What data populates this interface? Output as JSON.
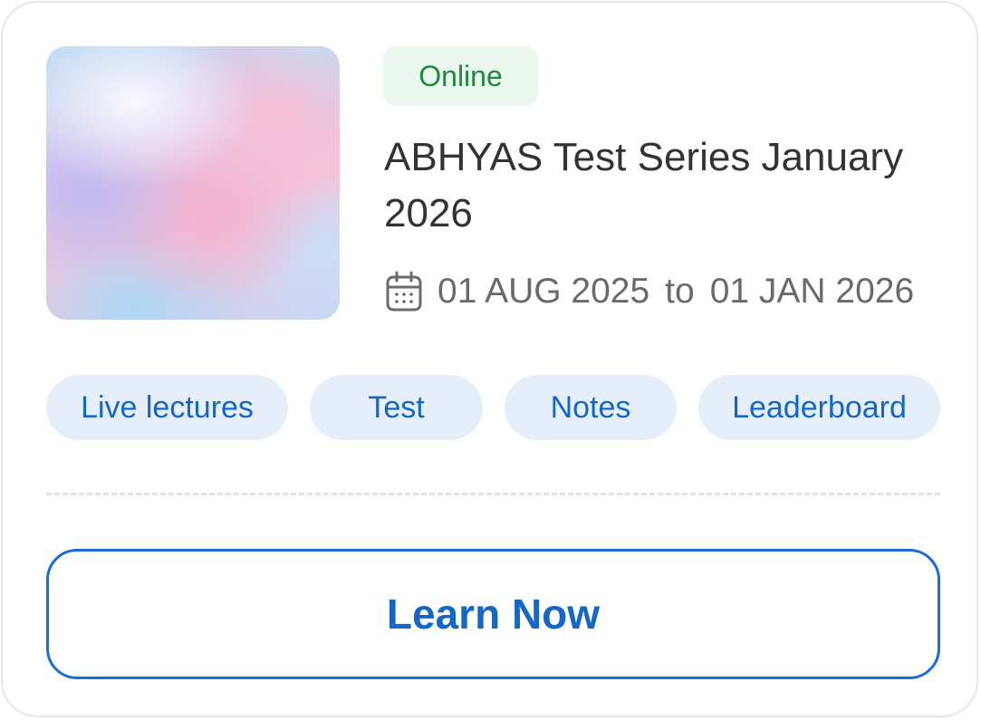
{
  "card": {
    "status_badge": "Online",
    "title": "ABHYAS Test Series January 2026",
    "date_start": "01 AUG 2025",
    "date_separator": "to",
    "date_end": "01 JAN 2026",
    "features": [
      "Live lectures",
      "Test",
      "Notes",
      "Leaderboard"
    ],
    "cta_label": "Learn Now"
  },
  "colors": {
    "badge_background": "#eaf7ee",
    "badge_text": "#1f8a3e",
    "chip_background": "#e6eefa",
    "accent": "#1466c7"
  },
  "icons": {
    "date": "calendar-icon"
  }
}
